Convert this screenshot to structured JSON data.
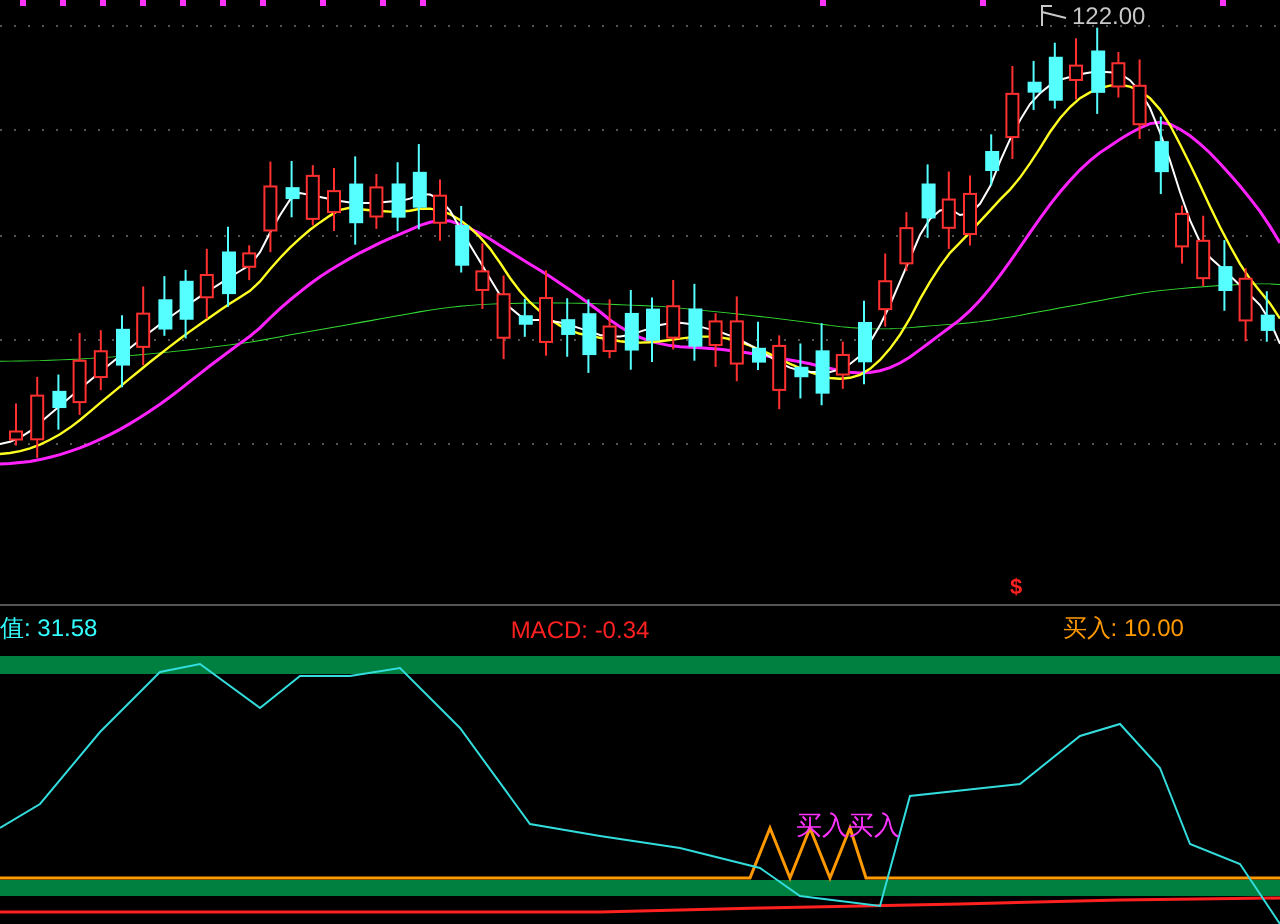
{
  "price_chart": {
    "high_label": "122.00",
    "signal_marker": "$"
  },
  "readouts": [
    {
      "text": "值: 31.58",
      "color": "#33ffff"
    },
    {
      "text": "MACD: -0.34",
      "color": "#ff2020"
    },
    {
      "text": "买入: 10.00",
      "color": "#ff9900"
    }
  ],
  "indicator_panel": {
    "buy_signals": [
      "买入",
      "买入"
    ]
  }
}
